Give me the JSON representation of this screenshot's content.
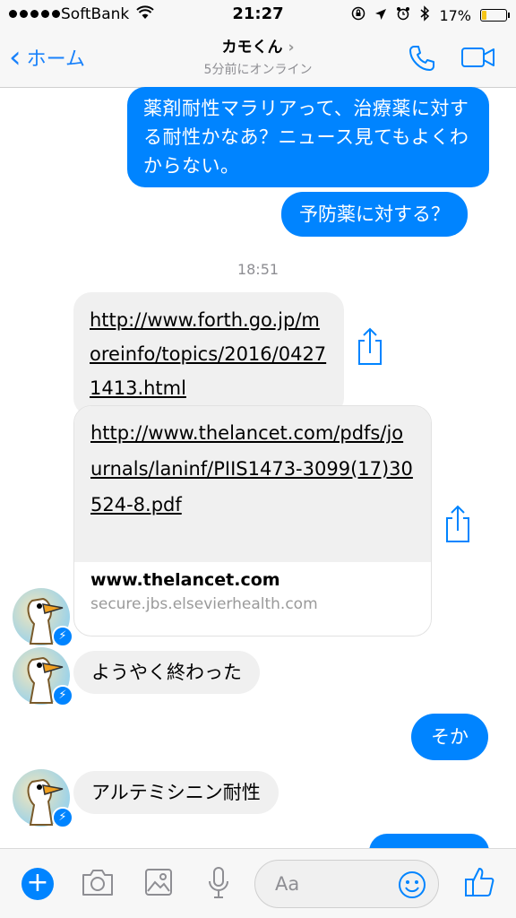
{
  "status_bar": {
    "carrier": "SoftBank",
    "time": "21:27",
    "battery_percent": "17%",
    "battery_level": 0.17
  },
  "nav": {
    "back_label": "ホーム",
    "title": "カモくん",
    "subtitle": "5分前にオンライン"
  },
  "messages": {
    "m1": "薬剤耐性マラリアって、治療薬に対する耐性かなあ？ニュース見てもよくわからない。",
    "m2": "予防薬に対する？",
    "timestamp": "18:51",
    "link1": "http://www.forth.go.jp/moreinfo/topics/2016/04271413.html",
    "link2": "http://www.thelancet.com/pdfs/journals/laninf/PIIS1473-3099(17)30524-8.pdf",
    "link2_host": "www.thelancet.com",
    "link2_sub": "secure.jbs.elsevierhealth.com",
    "m3": "ようやく終わった",
    "m4": "そか",
    "m5": "アルテミシニン耐性"
  },
  "composer": {
    "placeholder": "Aa"
  },
  "colors": {
    "accent": "#0084ff",
    "incoming_bubble": "#f0f0f0"
  }
}
